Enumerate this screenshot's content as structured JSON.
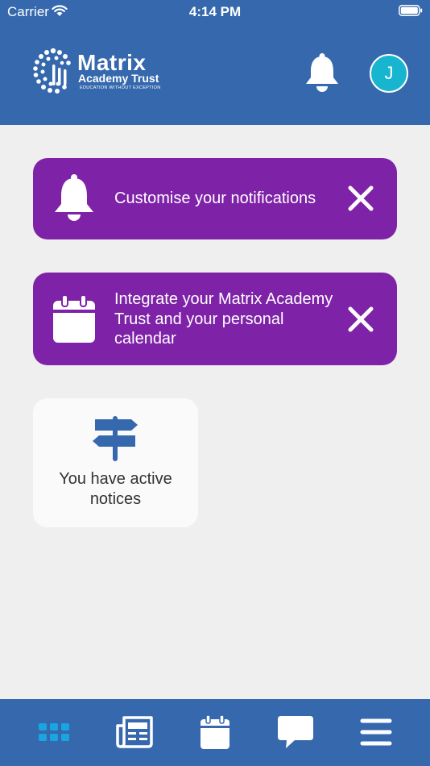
{
  "status": {
    "carrier": "Carrier",
    "time": "4:14 PM"
  },
  "header": {
    "logo_title": "Matrix",
    "logo_subtitle": "Academy Trust",
    "logo_tagline": "EDUCATION WITHOUT EXCEPTION",
    "avatar_initial": "J"
  },
  "cards": [
    {
      "text": "Customise your notifications",
      "icon": "bell-icon"
    },
    {
      "text": "Integrate your Matrix Academy Trust and your personal calendar",
      "icon": "calendar-icon"
    }
  ],
  "notice": {
    "text": "You have active notices",
    "icon": "signpost-icon"
  },
  "tabbar": {
    "items": [
      {
        "icon": "grid-icon",
        "active": true
      },
      {
        "icon": "newspaper-icon"
      },
      {
        "icon": "calendar-icon"
      },
      {
        "icon": "chat-icon"
      },
      {
        "icon": "menu-icon"
      }
    ]
  },
  "colors": {
    "header": "#3568ad",
    "card": "#7e22a8",
    "avatar": "#17b5cf",
    "active_tab": "#19a6e0",
    "background": "#efefef"
  }
}
